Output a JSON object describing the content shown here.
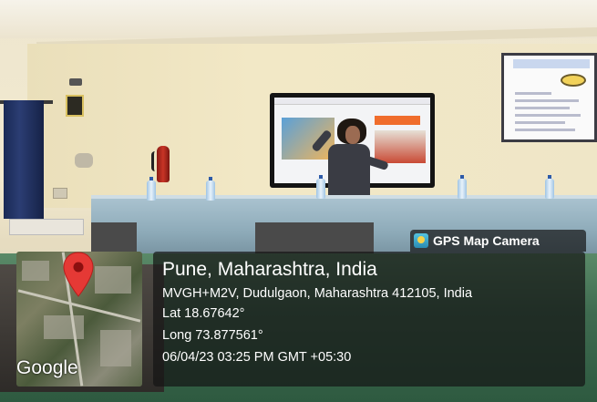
{
  "overlay": {
    "title": "Pune, Maharashtra, India",
    "address": "MVGH+M2V, Dudulgaon, Maharashtra 412105, India",
    "latitude": "Lat 18.67642°",
    "longitude": "Long 73.877561°",
    "timestamp": "06/04/23 03:25 PM GMT +05:30"
  },
  "badge": {
    "label": "GPS Map Camera",
    "icon": "gps-map-camera-icon"
  },
  "map": {
    "watermark": "Google",
    "pin_icon": "location-pin-icon",
    "pin_color": "#e53935"
  }
}
